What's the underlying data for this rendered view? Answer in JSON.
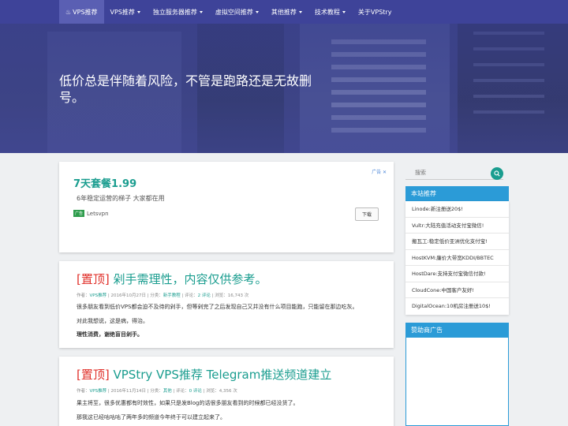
{
  "nav": {
    "items": [
      {
        "label": "VPS推荐",
        "dropdown": false,
        "active": true
      },
      {
        "label": "VPS推荐",
        "dropdown": true
      },
      {
        "label": "独立服务器推荐",
        "dropdown": true
      },
      {
        "label": "虚拟空间推荐",
        "dropdown": true
      },
      {
        "label": "其他推荐",
        "dropdown": true
      },
      {
        "label": "技术教程",
        "dropdown": true
      },
      {
        "label": "关于VPStry",
        "dropdown": false
      }
    ]
  },
  "hero": {
    "title": "低价总是伴随着风险，不管是跑路还是无故删号。"
  },
  "ad": {
    "tag": "广告 ✕",
    "title": "7天套餐1.99",
    "desc": "6年稳定运营的梯子 大家都在用",
    "brand_badge": "广告",
    "brand": "Letsvpn",
    "download": "下载"
  },
  "posts": [
    {
      "pin": "[置顶]",
      "title": "剁手需理性，内容仅供参考。",
      "meta": {
        "author_label": "作者：",
        "author": "VPS推荐",
        "date": " | 2016年10月27日 | 分类：",
        "category": "新手教程",
        "comments_sep": " | 评论：",
        "comments": "2 评论",
        "views": " | 浏览：16,743 次"
      },
      "lines": [
        {
          "text": "很多朋友看到低价VPS都会迫不及待的剁手，但等剁完了之后发现自己又并没有什么项目能跑，只能留在那边吃灰。",
          "bold": false
        },
        {
          "text": "对此我想说，这是病，得治。",
          "bold": false
        },
        {
          "text": "理性消费，谢绝盲目剁手。",
          "bold": true
        }
      ]
    },
    {
      "pin": "[置顶]",
      "title": "VPStry VPS推荐 Telegram推送频道建立",
      "meta": {
        "author_label": "作者：",
        "author": "VPS推荐",
        "date": " | 2016年11月14日 | 分类：",
        "category": "其他",
        "comments_sep": " | 评论：",
        "comments": "0 评论",
        "views": " | 浏览：4,356 次"
      },
      "lines": [
        {
          "text": "果主将至，很多优惠都有时效性，如果只是发Blog的话很多朋友看到的时候都已经没货了。",
          "bold": false
        },
        {
          "text": "那我这已经咕咕咕了两年多的频道今年终于可以建立起来了。",
          "bold": false
        }
      ]
    }
  ],
  "sidebar": {
    "search_placeholder": "搜索",
    "recommend_title": "本站推荐",
    "recommend_items": [
      "Linode:新注册送20$!",
      "Vultr:大陆充值活动支付宝微信!",
      "搬瓦工:稳定低价亚洲优化支付宝!",
      "HostKVM:廉价大带宽KDDI/BBTEC",
      "HostDare:支持支付宝微信付款!",
      "CloudCone:中国客户友好!",
      "DigitalOcean:10机房注册送10$!"
    ],
    "sponsor_title": "赞助商广告"
  },
  "colors": {
    "nav": "#3e4399",
    "accent": "#1a9d8f",
    "pin": "#e0302a",
    "widget": "#2b9bd7"
  }
}
